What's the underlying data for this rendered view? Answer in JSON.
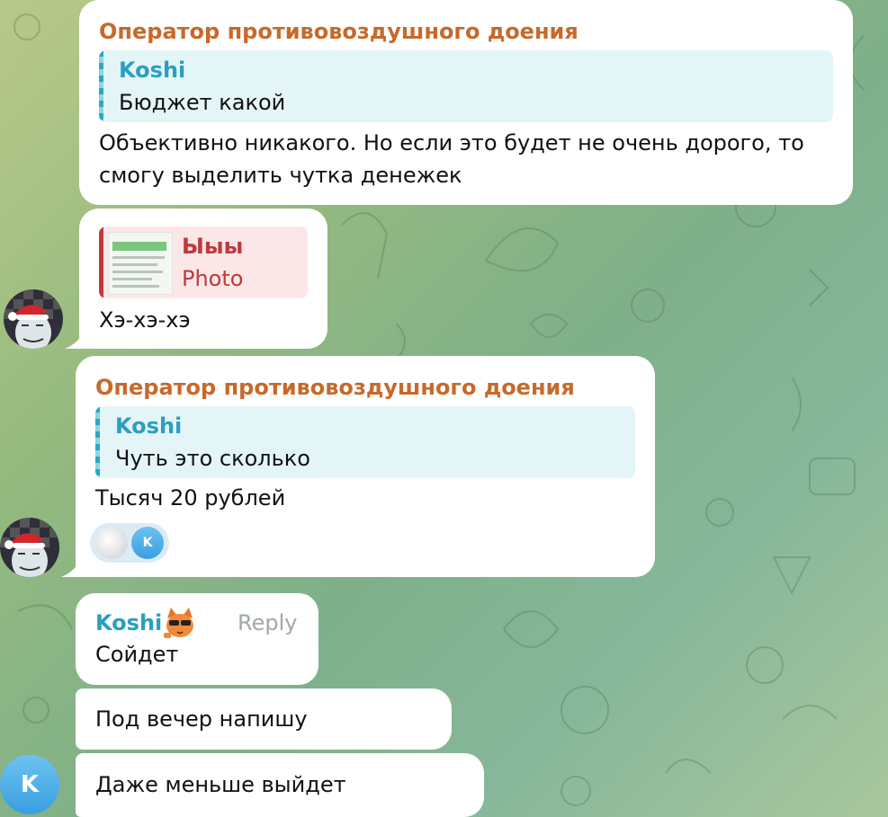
{
  "messages": {
    "m1": {
      "sender": "Оператор противовоздушного доения",
      "quote_name": "Koshi",
      "quote_text": "Бюджет какой",
      "text_line1": "Объективно никакого. Но если это будет не очень дорого, то",
      "text_line2": "смогу выделить чутка денежек"
    },
    "m2": {
      "quote_name": "Ыыы",
      "quote_text": "Photo",
      "text": "Хэ-хэ-хэ"
    },
    "m3": {
      "sender": "Оператор противовоздушного доения",
      "quote_name": "Koshi",
      "quote_text": "Чуть это сколько",
      "text": "Тысяч 20 рублей",
      "reaction_letter": "K"
    },
    "m4": {
      "sender": "Koshi",
      "reply_label": "Reply",
      "text": "Сойдет"
    },
    "m5": {
      "text": "Под вечер напишу"
    },
    "m6": {
      "text": "Даже меньше выйдет"
    }
  },
  "avatar_koshi_letter": "K",
  "colors": {
    "sender_orange": "#c8692a",
    "koshi_blue": "#2a9fc3",
    "quote_red": "#c0393b",
    "bubble": "#ffffff"
  }
}
